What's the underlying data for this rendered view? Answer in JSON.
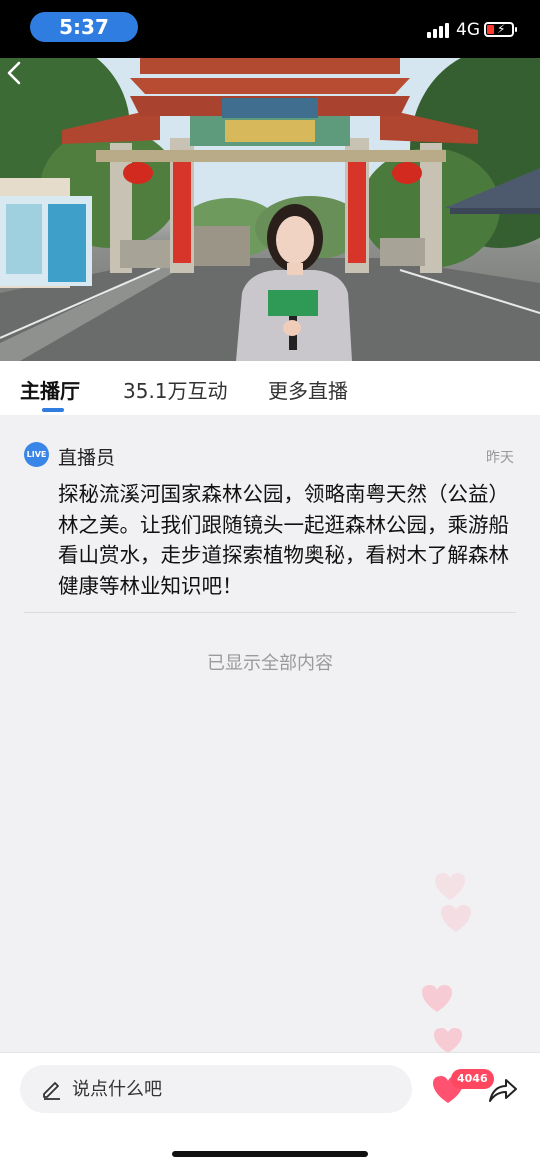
{
  "status_bar": {
    "time": "5:37",
    "network": "4G"
  },
  "video": {
    "back_icon": "chevron-left-icon"
  },
  "tabs": [
    {
      "label": "主播厅",
      "active": true
    },
    {
      "label": "35.1万互动",
      "active": false
    },
    {
      "label": "更多直播",
      "active": false
    }
  ],
  "message": {
    "badge": "LIVE",
    "author": "直播员",
    "time": "昨天",
    "text": "探秘流溪河国家森林公园，领略南粤天然（公益）林之美。让我们跟随镜头一起逛森林公园，乘游船看山赏水，走步道探索植物奥秘，看树木了解森林健康等林业知识吧！"
  },
  "end_note": "已显示全部内容",
  "bottom_bar": {
    "comment_placeholder": "说点什么吧",
    "like_count": "4046",
    "share_icon": "share-arrow-icon",
    "like_icon": "heart-icon",
    "pen_icon": "pen-icon"
  },
  "colors": {
    "accent": "#2f7de1",
    "like": "#ff4760",
    "badge": "#3a86e8"
  }
}
